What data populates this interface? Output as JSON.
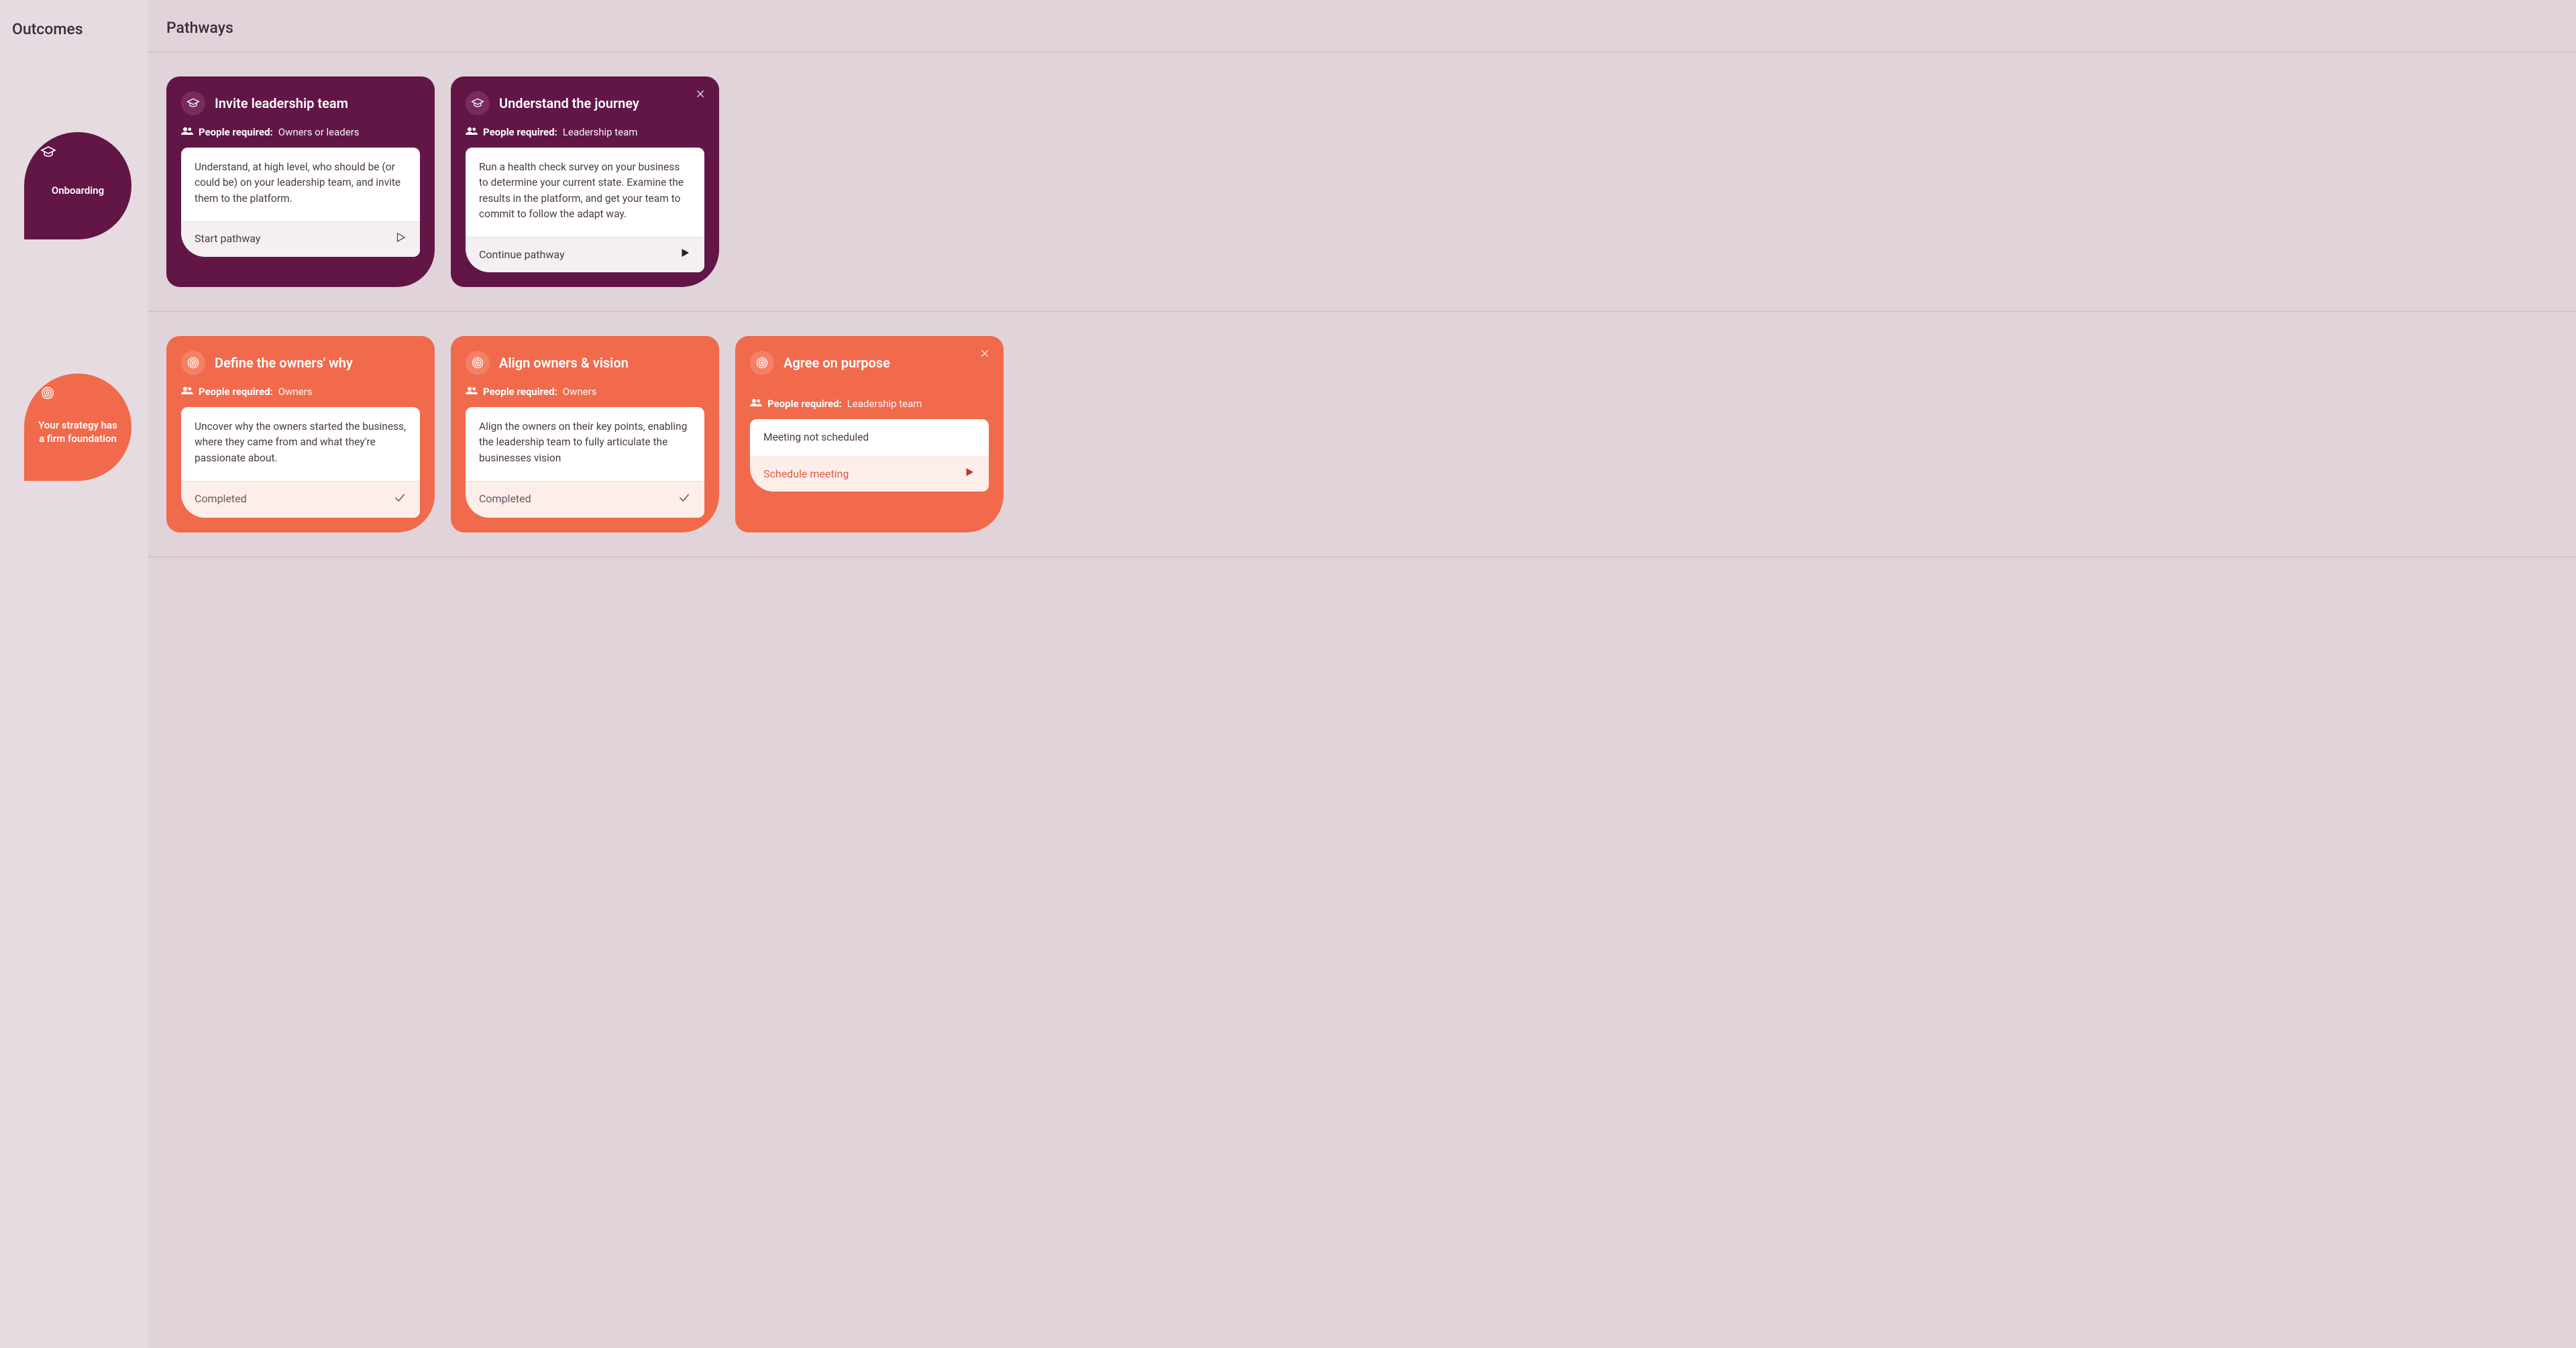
{
  "sidebar": {
    "title": "Outcomes",
    "outcomes": [
      {
        "id": "onboarding",
        "label": "Onboarding",
        "color": "purple",
        "icon": "graduation"
      },
      {
        "id": "foundation",
        "label": "Your strategy has a firm foundation",
        "color": "orange",
        "icon": "target"
      }
    ]
  },
  "main": {
    "title": "Pathways"
  },
  "labels": {
    "people_required": "People required:"
  },
  "sections": [
    {
      "color": "purple",
      "cards": [
        {
          "title": "Invite leadership team",
          "icon": "graduation",
          "closable": false,
          "people": "Owners or leaders",
          "description": "Understand, at high level, who should be (or could be) on your leadership team, and invite them to the platform.",
          "status_text": null,
          "action": {
            "label": "Start pathway",
            "icon": "play-outline"
          }
        },
        {
          "title": "Understand the journey",
          "icon": "graduation",
          "closable": true,
          "people": "Leadership team",
          "description": "Run a health check survey on your business to determine your current state. Examine the results in the platform, and get your team to commit to follow the adapt way.",
          "status_text": null,
          "action": {
            "label": "Continue pathway",
            "icon": "play-solid"
          }
        }
      ]
    },
    {
      "color": "orange",
      "cards": [
        {
          "title": "Define the owners' why",
          "icon": "target",
          "closable": false,
          "people": "Owners",
          "description": "Uncover why the owners started the business, where they came from and what they're passionate about.",
          "status_text": null,
          "action": {
            "label": "Completed",
            "icon": "check"
          }
        },
        {
          "title": "Align owners & vision",
          "icon": "target",
          "closable": false,
          "people": "Owners",
          "description": "Align the owners on their key points, enabling the leadership team to fully articulate the businesses vision",
          "status_text": null,
          "action": {
            "label": "Completed",
            "icon": "check"
          }
        },
        {
          "title": "Agree on purpose",
          "icon": "target",
          "closable": true,
          "people": "Leadership team",
          "description": null,
          "status_text": "Meeting not scheduled",
          "action": {
            "label": "Schedule meeting",
            "icon": "play-solid-orange"
          }
        }
      ]
    }
  ]
}
